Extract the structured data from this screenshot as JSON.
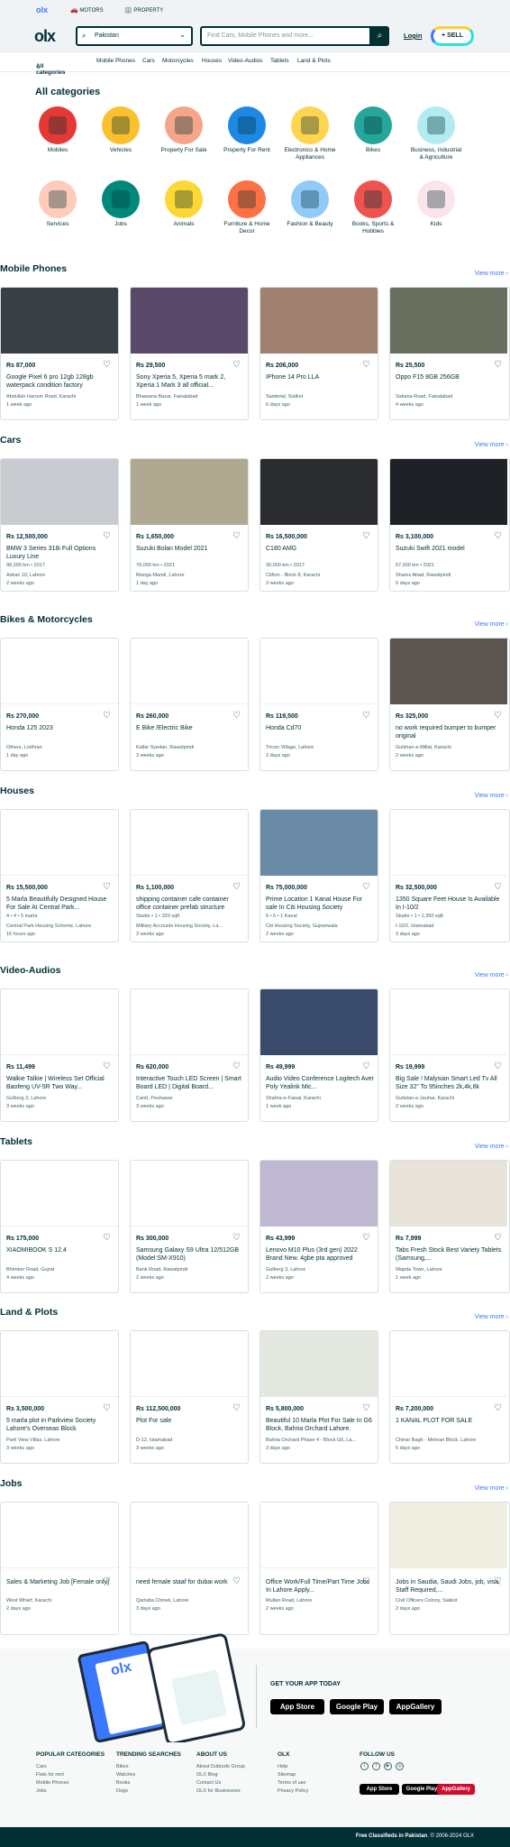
{
  "topbar": {
    "motors": "MOTORS",
    "property": "PROPERTY"
  },
  "header": {
    "location_value": "Pakistan",
    "search_placeholder": "Find Cars, Mobile Phones and more...",
    "login": "Login",
    "sell": "SELL"
  },
  "catnav": {
    "all": "All categories",
    "items": [
      "Mobile Phones",
      "Cars",
      "Motorcycles",
      "Houses",
      "Video-Audios",
      "Tablets",
      "Land & Plots"
    ]
  },
  "categories_title": "All categories",
  "categories": [
    {
      "label": "Mobiles",
      "color": "#e53935"
    },
    {
      "label": "Vehicles",
      "color": "#fbc02d"
    },
    {
      "label": "Property For Sale",
      "color": "#f4a58a"
    },
    {
      "label": "Property For Rent",
      "color": "#1e88e5"
    },
    {
      "label": "Electronics & Home Appliances",
      "color": "#ffd54f"
    },
    {
      "label": "Bikes",
      "color": "#26a69a"
    },
    {
      "label": "Business, Industrial & Agriculture",
      "color": "#b2ebf2"
    },
    {
      "label": "Services",
      "color": "#ffccbc"
    },
    {
      "label": "Jobs",
      "color": "#00897b"
    },
    {
      "label": "Animals",
      "color": "#fdd835"
    },
    {
      "label": "Furniture & Home Decor",
      "color": "#ff7043"
    },
    {
      "label": "Fashion & Beauty",
      "color": "#90caf9"
    },
    {
      "label": "Books, Sports & Hobbies",
      "color": "#ef5350"
    },
    {
      "label": "Kids",
      "color": "#fce4ec"
    }
  ],
  "view_more": "View more",
  "sections": [
    {
      "title": "Mobile Phones",
      "items": [
        {
          "price": "Rs 87,000",
          "title": "Google Pixel 6 pro 12gb 128gb waterpack condition factory",
          "specs": "",
          "location": "Abdullah Haroon Road, Karachi",
          "time": "1 week ago",
          "img": "#3a3f45"
        },
        {
          "price": "Rs 29,500",
          "title": "Sony Xperia 5, Xperia 5 mark 2, Xperia 1 Mark 3 all official...",
          "specs": "",
          "location": "Bhawana Bazar, Faisalabad",
          "time": "1 week ago",
          "img": "#5a4a6a"
        },
        {
          "price": "Rs 206,000",
          "title": "IPhone 14 Pro LLA",
          "specs": "",
          "location": "Sambrial, Sialkot",
          "time": "6 days ago",
          "img": "#a08070"
        },
        {
          "price": "Rs 25,500",
          "title": "Oppo F15 8GB 256GB",
          "specs": "",
          "location": "Satiana Road, Faisalabad",
          "time": "4 weeks ago",
          "img": "#6a7060"
        }
      ]
    },
    {
      "title": "Cars",
      "items": [
        {
          "price": "Rs 12,500,000",
          "title": "BMW 3 Series 318i Full Options Luxury Line",
          "specs": "98,300 km • 2017",
          "location": "Askari 10, Lahore",
          "time": "2 weeks ago",
          "img": "#c8ccd0"
        },
        {
          "price": "Rs 1,650,000",
          "title": "Suzuki Bolan Model 2021",
          "specs": "79,000 km • 2021",
          "location": "Manga Mandi, Lahore",
          "time": "1 day ago",
          "img": "#b0a890"
        },
        {
          "price": "Rs 16,500,000",
          "title": "C180 AMG",
          "specs": "30,000 km • 2017",
          "location": "Clifton - Block 8, Karachi",
          "time": "3 weeks ago",
          "img": "#2a2c30"
        },
        {
          "price": "Rs 3,100,000",
          "title": "Suzuki Swift 2021 model",
          "specs": "67,000 km • 2021",
          "location": "Shams Abad, Rawalpindi",
          "time": "5 days ago",
          "img": "#1e2226"
        }
      ]
    },
    {
      "title": "Bikes & Motorcycles",
      "items": [
        {
          "price": "Rs 270,000",
          "title": "Honda 125 2023",
          "specs": "",
          "location": "Others, Lodhran",
          "time": "1 day ago",
          "img": "#ffffff"
        },
        {
          "price": "Rs 260,000",
          "title": "E Bike /Electric Bike",
          "specs": "",
          "location": "Kallar Syedan, Rawalpindi",
          "time": "3 weeks ago",
          "img": "#ffffff"
        },
        {
          "price": "Rs 119,500",
          "title": "Honda Cd70",
          "specs": "",
          "location": "Tricon Village, Lahore",
          "time": "2 days ago",
          "img": "#ffffff"
        },
        {
          "price": "Rs 325,000",
          "title": "no work required bumper to bumper original",
          "specs": "",
          "location": "Gulshan-e-Millat, Karachi",
          "time": "2 weeks ago",
          "img": "#5a5550"
        }
      ]
    },
    {
      "title": "Houses",
      "items": [
        {
          "price": "Rs 15,500,000",
          "title": "5 Marla Beautifully Designed House For Sale At Central Park...",
          "specs": "4 • 4 • 5 marla",
          "location": "Central Park Housing Scheme, Lahore",
          "time": "16 hours ago",
          "img": "#ffffff"
        },
        {
          "price": "Rs 1,100,000",
          "title": "shipping container cafe container office container prefab structure",
          "specs": "Studio • 1 • 320 sqft",
          "location": "Military Accounts Housing Society, La...",
          "time": "3 weeks ago",
          "img": "#ffffff"
        },
        {
          "price": "Rs 75,000,000",
          "title": "Prime Location 1 Kanal House For sale In Citi Housing Society",
          "specs": "6 • 6 • 1 Kanal",
          "location": "Citi Housing Society, Gujranwala",
          "time": "2 weeks ago",
          "img": "#6a8aa8"
        },
        {
          "price": "Rs 32,500,000",
          "title": "1350 Square Feet House Is Available In I-10/2",
          "specs": "Studio • 1 • 1,350 sqft",
          "location": "I-10/2, Islamabad",
          "time": "3 days ago",
          "img": "#ffffff"
        }
      ]
    },
    {
      "title": "Video-Audios",
      "items": [
        {
          "price": "Rs 11,499",
          "title": "Walkie Talkie | Wireless Set Official Baofeng UV-5R Two Way...",
          "specs": "",
          "location": "Gulberg 3, Lahore",
          "time": "3 weeks ago",
          "img": "#ffffff"
        },
        {
          "price": "Rs 620,000",
          "title": "Interactive Touch LED Screen | Smart Board LED | Digital Board...",
          "specs": "",
          "location": "Cantt, Peshawar",
          "time": "3 weeks ago",
          "img": "#ffffff"
        },
        {
          "price": "Rs 49,999",
          "title": "Audio Video Conference Logitech Aver Poly Yealink Mic...",
          "specs": "",
          "location": "Shahra-e-Faisal, Karachi",
          "time": "1 week ago",
          "img": "#3a4a6a"
        },
        {
          "price": "Rs 19,999",
          "title": "Big Sale ! Malysian Smart Led Tv All Size 32\" To 95inches 2k,4k,8k",
          "specs": "",
          "location": "Gulistan-e-Jauhar, Karachi",
          "time": "2 weeks ago",
          "img": "#ffffff"
        }
      ]
    },
    {
      "title": "Tablets",
      "items": [
        {
          "price": "Rs 175,000",
          "title": "XIAOMIBOOK S 12.4",
          "specs": "",
          "location": "Bhimber Road, Gujrat",
          "time": "4 weeks ago",
          "img": "#ffffff"
        },
        {
          "price": "Rs 300,000",
          "title": "Samsung Galaxy S9 Ultra 12/512GB (Model:SM-X910)",
          "specs": "",
          "location": "Bank Road, Rawalpindi",
          "time": "2 weeks ago",
          "img": "#ffffff"
        },
        {
          "price": "Rs 43,999",
          "title": "Lenovo M10 Plus (3rd gen) 2022 Brand New. 4gbe pta approved",
          "specs": "",
          "location": "Gulberg 3, Lahore",
          "time": "2 weeks ago",
          "img": "#c0b8d0"
        },
        {
          "price": "Rs 7,999",
          "title": "Tabs Fresh Stock Best Variety Tablets (Samsung,...",
          "specs": "",
          "location": "Wapda Town, Lahore",
          "time": "1 week ago",
          "img": "#e8e4dc"
        }
      ]
    },
    {
      "title": "Land & Plots",
      "items": [
        {
          "price": "Rs 3,500,000",
          "title": "5 marla plot in Parkview Society Lahore's Overseas Block",
          "specs": "",
          "location": "Park View Villas, Lahore",
          "time": "3 weeks ago",
          "img": "#ffffff"
        },
        {
          "price": "Rs 112,500,000",
          "title": "Plot For sale",
          "specs": "",
          "location": "D-12, Islamabad",
          "time": "3 weeks ago",
          "img": "#ffffff"
        },
        {
          "price": "Rs 5,800,000",
          "title": "Beautiful 10 Marla Plot For Sale In G6 Block, Bahria Orchard Lahore.",
          "specs": "",
          "location": "Bahria Orchard Phase 4 - Block G6, La...",
          "time": "3 days ago",
          "img": "#e4e8e0"
        },
        {
          "price": "Rs 7,200,000",
          "title": "1 KANAL PLOT FOR SALE",
          "specs": "",
          "location": "Chinar Bagh - Mehran Block, Lahore",
          "time": "5 days ago",
          "img": "#ffffff"
        }
      ]
    },
    {
      "title": "Jobs",
      "items": [
        {
          "price": "",
          "title": "Sales & Marketing Job [Female only]",
          "specs": "",
          "location": "West Wharf, Karachi",
          "time": "2 days ago",
          "img": "#ffffff"
        },
        {
          "price": "",
          "title": "need female staaf for dubai work",
          "specs": "",
          "location": "Qartaba Chowk, Lahore",
          "time": "3 days ago",
          "img": "#ffffff"
        },
        {
          "price": "",
          "title": "Office Work/Full Time/Part Time Jobs In Lahore Apply...",
          "specs": "",
          "location": "Multan Road, Lahore",
          "time": "2 weeks ago",
          "img": "#ffffff"
        },
        {
          "price": "",
          "title": "Jobs in Saudia, Saudi Jobs, job, visa, Staff Required,...",
          "specs": "",
          "location": "Civil Officers Colony, Sialkot",
          "time": "2 days ago",
          "img": "#f0eee0"
        }
      ]
    }
  ],
  "app": {
    "title": "GET YOUR APP TODAY",
    "stores": [
      "App Store",
      "Google Play",
      "AppGallery"
    ]
  },
  "footer": {
    "columns": [
      {
        "title": "POPULAR CATEGORIES",
        "links": [
          "Cars",
          "Flats for rent",
          "Mobile Phones",
          "Jobs"
        ]
      },
      {
        "title": "TRENDING SEARCHES",
        "links": [
          "Bikes",
          "Watches",
          "Books",
          "Dogs"
        ]
      },
      {
        "title": "ABOUT US",
        "links": [
          "About Dubizzle Group",
          "OLX Blog",
          "Contact Us",
          "OLX for Businesses"
        ]
      },
      {
        "title": "OLX",
        "links": [
          "Help",
          "Sitemap",
          "Terms of use",
          "Privacy Policy"
        ]
      }
    ],
    "follow": "FOLLOW US",
    "copyright_bold": "Free Classifieds in Pakistan",
    "copyright": ". © 2006-2024 OLX"
  }
}
